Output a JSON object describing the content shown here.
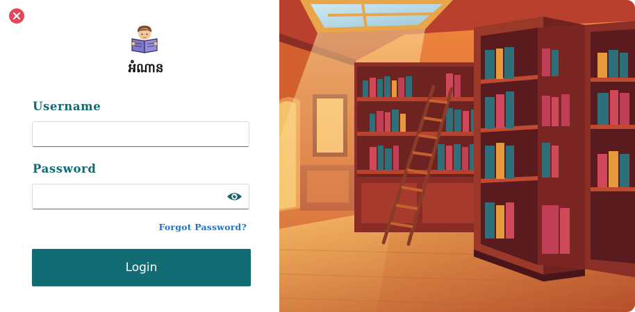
{
  "app": {
    "name": "អំណាន",
    "logo": "boy-reading-book-icon"
  },
  "form": {
    "username_label": "Username",
    "username_value": "",
    "password_label": "Password",
    "password_value": "",
    "toggle_visibility_icon": "eye-icon",
    "forgot_password": "Forgot Password?",
    "login_button": "Login"
  },
  "window": {
    "close_icon": "close-icon"
  },
  "colors": {
    "accent": "#116c73",
    "link": "#1e74c6",
    "close": "#e2475b"
  },
  "illustration": {
    "subject": "library-interior-illustration"
  }
}
